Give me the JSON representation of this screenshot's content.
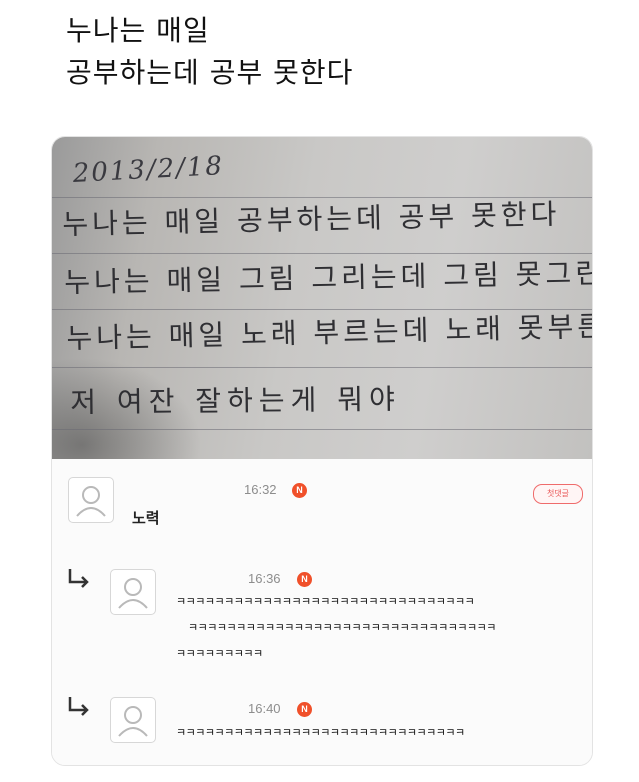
{
  "tweet": {
    "title_line1": "누나는 매일",
    "title_line2": "공부하는데 공부 못한다"
  },
  "photo": {
    "date": "2013/2/18",
    "lines": [
      "누나는 매일 공부하는데 공부 못한다",
      "누나는 매일 그림 그리는데 그림 못그린다",
      "누나는 매일 노래 부르는데 노래 못부른다",
      "저 여잔 잘하는게 뭐야"
    ]
  },
  "comments": [
    {
      "time": "16:32",
      "badge": "N",
      "first_badge": "첫댓글",
      "author": "노력"
    },
    {
      "time": "16:36",
      "badge": "N",
      "text_lines": [
        "ㅋㅋㅋㅋㅋㅋㅋㅋㅋㅋㅋㅋㅋㅋㅋㅋㅋㅋㅋㅋㅋㅋㅋㅋㅋㅋㅋㅋㅋㅋㅋ",
        "ㅋㅋㅋㅋㅋㅋㅋㅋㅋㅋㅋㅋㅋㅋㅋㅋㅋㅋㅋㅋㅋㅋㅋㅋㅋㅋㅋㅋㅋㅋㅋㅋ",
        "ㅋㅋㅋㅋㅋㅋㅋㅋㅋ"
      ]
    },
    {
      "time": "16:40",
      "badge": "N",
      "text_lines": [
        "ㅋㅋㅋㅋㅋㅋㅋㅋㅋㅋㅋㅋㅋㅋㅋㅋㅋㅋㅋㅋㅋㅋㅋㅋㅋㅋㅋㅋㅋㅋ"
      ]
    }
  ],
  "icons": {
    "avatar": "default-profile-icon",
    "reply": "reply-arrow-icon"
  },
  "colors": {
    "new_badge": "#f0502a",
    "first_badge": "#ea5a5a"
  }
}
